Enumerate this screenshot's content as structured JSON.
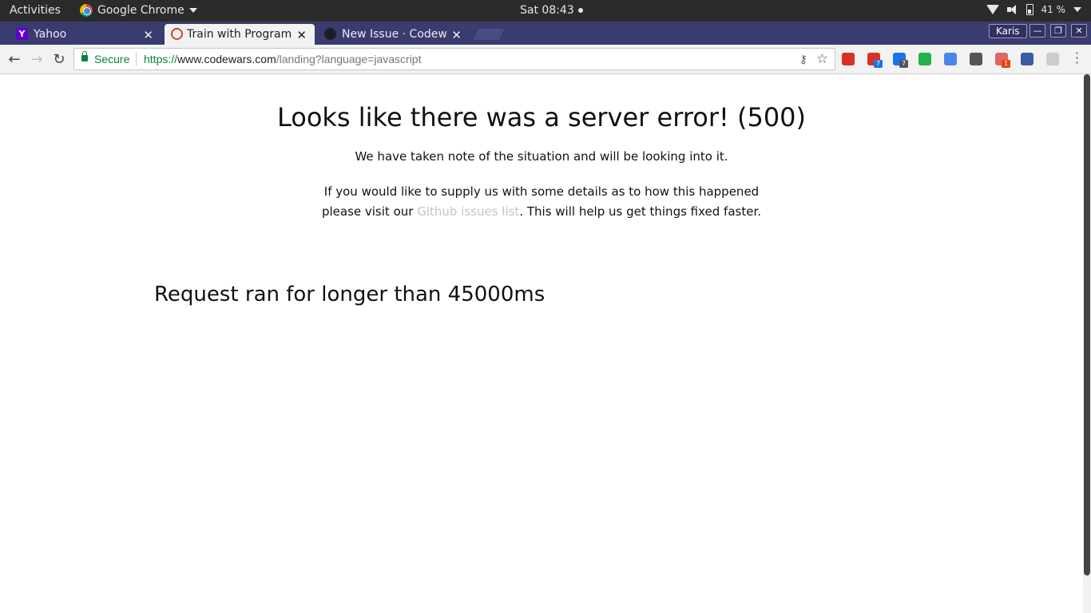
{
  "system_bar": {
    "activities": "Activities",
    "app_name": "Google Chrome",
    "clock": "Sat 08:43",
    "battery": "41 %"
  },
  "tabs": [
    {
      "title": "Yahoo",
      "favicon": "yahoo-icon",
      "active": false
    },
    {
      "title": "Train with Programmi",
      "favicon": "codewars-icon",
      "active": true
    },
    {
      "title": "New Issue · Codewa",
      "favicon": "github-icon",
      "active": false
    }
  ],
  "window": {
    "profile_name": "Karis"
  },
  "omnibox": {
    "security_label": "Secure",
    "url_scheme": "https://",
    "url_host": "www.codewars.com",
    "url_path": "/landing?language=javascript"
  },
  "extensions": [
    {
      "name": "red-play-extension",
      "color": "#d93025"
    },
    {
      "name": "red-circle-extension",
      "color": "#d93025",
      "badge": "7",
      "badge_color": "#1a73e8"
    },
    {
      "name": "blue-s-extension",
      "color": "#1a73e8",
      "badge": "7",
      "badge_color": "#555555"
    },
    {
      "name": "green-ring-extension",
      "color": "#22b14c"
    },
    {
      "name": "translate-extension",
      "color": "#4a86e8"
    },
    {
      "name": "evernote-extension",
      "color": "#555555"
    },
    {
      "name": "red-gear-extension",
      "color": "#e06666",
      "badge": "1",
      "badge_color": "#e8430c"
    },
    {
      "name": "blue-stamp-extension",
      "color": "#3b5ba5"
    },
    {
      "name": "grey-leaf-extension",
      "color": "#cccccc"
    }
  ],
  "page": {
    "error_title": "Looks like there was a server error! (500)",
    "error_note": "We have taken note of the situation and will be looking into it.",
    "details_prefix": "If you would like to supply us with some details as to how this happened please visit our",
    "details_link": "Github issues list",
    "details_suffix": ". This will help us get things fixed faster.",
    "request_message": "Request ran for longer than 45000ms"
  }
}
